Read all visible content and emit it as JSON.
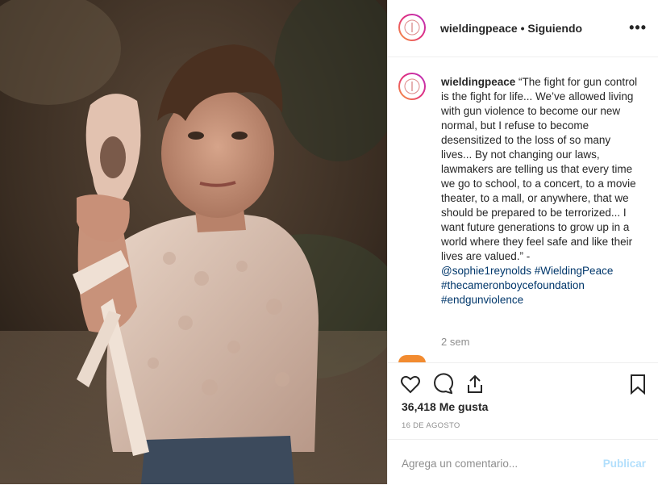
{
  "post": {
    "username": "wieldingpeace",
    "separator": "•",
    "follow_status": "Siguiendo",
    "more_icon": "more-horizontal-icon"
  },
  "caption": {
    "username": "wieldingpeace",
    "text": "“The fight for gun control is the fight for life... We’ve allowed living with gun violence to become our new normal, but I refuse to become desensitized to the loss of so many lives... By not changing our laws, lawmakers are telling us that every time we go to school, to a concert, to a movie theater, to a mall, or anywhere, that we should be prepared to be terrorized... I want future generations to grow up in a world where they feel safe and like their lives are valued.” -",
    "tags": [
      "@sophie1reynolds #WieldingPeace",
      "#thecameronboycefoundation",
      "#endgunviolence"
    ],
    "age": "2 sem"
  },
  "actions": {
    "icons": [
      "heart-icon",
      "comment-icon",
      "share-icon",
      "bookmark-icon"
    ],
    "likes": "36,418 Me gusta",
    "date": "16 DE AGOSTO"
  },
  "comment": {
    "placeholder": "Agrega un comentario...",
    "post_label": "Publicar"
  },
  "colors": {
    "text": "#262626",
    "muted": "#8e8e8e",
    "link": "#00376b",
    "post_disabled": "#b2dffc"
  }
}
